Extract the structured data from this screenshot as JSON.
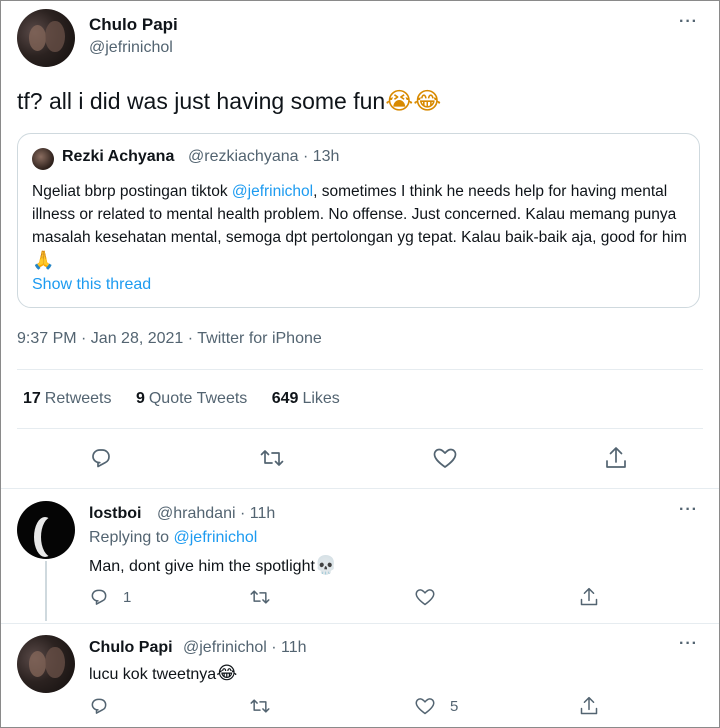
{
  "tweet": {
    "author_name": "Chulo Papi",
    "author_handle": "@jefrinichol",
    "more": "···",
    "text": "tf? all i did was just having some fun",
    "emojis": "😭😂",
    "quote": {
      "author_name": "Rezki Achyana",
      "author_handle": "@rezkiachyana",
      "time": "· 13h",
      "body_before": "Ngeliat bbrp postingan tiktok ",
      "mention": "@jefrinichol",
      "body_after": ", sometimes I think he needs help for having mental illness or related to mental health problem. No offense. Just concerned. Kalau memang punya masalah kesehatan mental, semoga dpt pertolongan yg tepat. Kalau baik-baik aja, good for him",
      "emoji": "🙏",
      "thread_link": "Show this thread"
    },
    "timestamp": "9:37 PM · Jan 28, 2021 · Twitter for iPhone",
    "stats": {
      "retweets_count": "17",
      "retweets_label": "Retweets",
      "quotes_count": "9",
      "quotes_label": "Quote Tweets",
      "likes_count": "649",
      "likes_label": "Likes"
    }
  },
  "replies": [
    {
      "author_name": "lostboi",
      "author_handle": "@hrahdani",
      "time": "· 11h",
      "replying_prefix": "Replying to",
      "replying_handle": "@jefrinichol",
      "text": "Man, dont give him the spotlight",
      "emoji": "💀",
      "reply_count": "1",
      "like_count": "",
      "more": "···"
    },
    {
      "author_name": "Chulo Papi",
      "author_handle": "@jefrinichol",
      "time": "· 11h",
      "text": "lucu kok tweetnya",
      "emoji": "😂",
      "reply_count": "",
      "like_count": "5",
      "more": "···"
    }
  ],
  "icons": {
    "reply": "reply-icon",
    "retweet": "retweet-icon",
    "like": "heart-icon",
    "share": "share-icon"
  },
  "colors": {
    "link": "#1d9bf0",
    "secondary_text": "#536471",
    "border": "#cfd9de"
  }
}
